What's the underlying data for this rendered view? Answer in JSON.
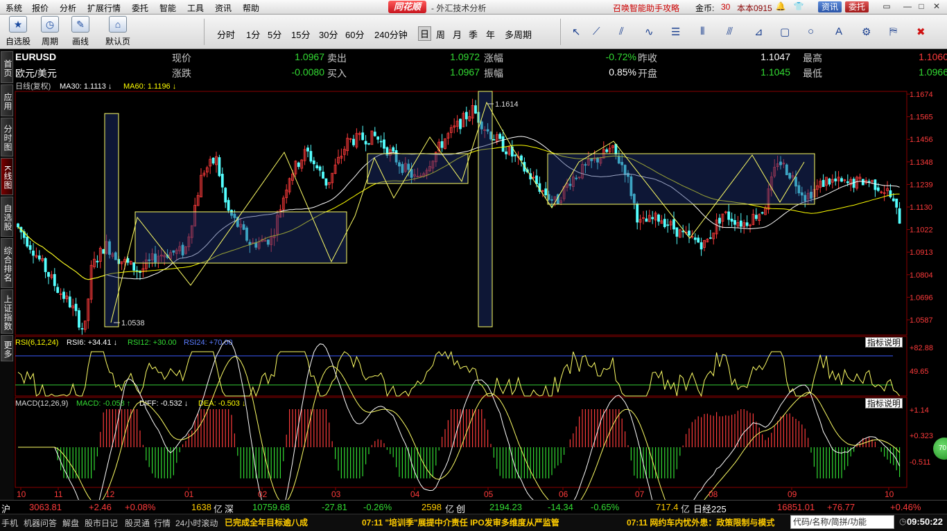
{
  "menubar": {
    "items": [
      "系统",
      "报价",
      "分析",
      "扩展行情",
      "委托",
      "智能",
      "工具",
      "资讯",
      "帮助"
    ],
    "brand": "同花顺",
    "title": "- 外汇技术分析",
    "promo": "召唤智能助手攻略",
    "gold_label": "金币:",
    "gold_value": "30",
    "username": "本本0915",
    "news_btn": "资讯",
    "trade_btn": "委托"
  },
  "toolbar": {
    "buttons": [
      {
        "label": "自选股",
        "icon": "star-icon"
      },
      {
        "label": "周期",
        "icon": "clock-icon"
      },
      {
        "label": "画线",
        "icon": "pencil-icon"
      },
      {
        "label": "默认页",
        "icon": "home-icon"
      }
    ],
    "periods": [
      "分时",
      "1分",
      "5分",
      "15分",
      "30分",
      "60分",
      "240分钟",
      "日",
      "周",
      "月",
      "季",
      "年",
      "多周期"
    ],
    "selected_period": "日"
  },
  "sidebar": {
    "tabs": [
      "首页",
      "应用",
      "分时图",
      "K线图",
      "自选股",
      "综合排名",
      "上证指数",
      "更多"
    ],
    "active": "K线图"
  },
  "quote": {
    "symbol": "EURUSD",
    "name": "欧元/美元",
    "row1": [
      {
        "label": "现价",
        "value": "1.0967",
        "color": "green"
      },
      {
        "label": "卖出",
        "value": "1.0972",
        "color": "green"
      },
      {
        "label": "涨幅",
        "value": "-0.72%",
        "color": "green"
      },
      {
        "label": "昨收",
        "value": "1.1047",
        "color": "white"
      },
      {
        "label": "最高",
        "value": "1.1060",
        "color": "red"
      }
    ],
    "row2": [
      {
        "label": "涨跌",
        "value": "-0.0080",
        "color": "green"
      },
      {
        "label": "买入",
        "value": "1.0967",
        "color": "green"
      },
      {
        "label": "振幅",
        "value": "0.85%",
        "color": "white"
      },
      {
        "label": "开盘",
        "value": "1.1045",
        "color": "green"
      },
      {
        "label": "最低",
        "value": "1.0966",
        "color": "green"
      }
    ]
  },
  "kline": {
    "header_type": "日线(复权)",
    "ma30_label": "MA30: 1.1113",
    "ma60_label": "MA60: 1.1196",
    "y_ticks": [
      "1.1674",
      "1.1565",
      "1.1456",
      "1.1348",
      "1.1239",
      "1.1130",
      "1.1022",
      "1.0913",
      "1.0804",
      "1.0696",
      "1.0587"
    ],
    "annot_high": "1.1614",
    "annot_low": "1.0538"
  },
  "rsi": {
    "label": "RSI(6,12,24)",
    "rsi6": "RSI6: +34.41",
    "rsi12": "RSI12: +30.00",
    "rsi24": "RSI24: +70.00",
    "ticks": [
      "+82.88",
      "49.65"
    ],
    "button": "指标说明"
  },
  "macd": {
    "label": "MACD(12,26,9)",
    "macd": "MACD: -0.058",
    "diff": "DIFF: -0.532",
    "dea": "DEA: -0.503",
    "ticks": [
      "+1.14",
      "+0.323",
      "-0.511"
    ],
    "button": "指标说明"
  },
  "xaxis": [
    "10",
    "11",
    "12",
    "01",
    "02",
    "03",
    "04",
    "05",
    "06",
    "07",
    "08",
    "09",
    "10"
  ],
  "status1": [
    {
      "t": "沪",
      "c": "#fff"
    },
    {
      "t": "3063.81",
      "c": "#ff3b3b"
    },
    {
      "t": "+2.46",
      "c": "#ff3b3b"
    },
    {
      "t": "+0.08%",
      "c": "#ff3b3b"
    },
    {
      "t": "1638",
      "c": "#ffcc00"
    },
    {
      "t": "亿",
      "c": "#ddd"
    },
    {
      "t": "深",
      "c": "#fff"
    },
    {
      "t": "10759.68",
      "c": "#33dd33"
    },
    {
      "t": "-27.81",
      "c": "#33dd33"
    },
    {
      "t": "-0.26%",
      "c": "#33dd33"
    },
    {
      "t": "2598",
      "c": "#ffcc00"
    },
    {
      "t": "亿",
      "c": "#ddd"
    },
    {
      "t": "创",
      "c": "#fff"
    },
    {
      "t": "2194.23",
      "c": "#33dd33"
    },
    {
      "t": "-14.34",
      "c": "#33dd33"
    },
    {
      "t": "-0.65%",
      "c": "#33dd33"
    },
    {
      "t": "717.4",
      "c": "#ffcc00"
    },
    {
      "t": "亿",
      "c": "#ddd"
    },
    {
      "t": "日经225",
      "c": "#fff"
    },
    {
      "t": "16851.01",
      "c": "#ff3b3b"
    },
    {
      "t": "+76.77",
      "c": "#ff3b3b"
    },
    {
      "t": "+0.46%",
      "c": "#ff3b3b"
    }
  ],
  "status2": {
    "tabs": [
      "手机",
      "机器问答",
      "解盘",
      "股市日记",
      "股灵通",
      "行情",
      "24小时滚动"
    ],
    "news": [
      "已完成全年目标逾八成",
      "07:11 \"培训季\"展提中介责任 IPO发审多维度从严监管",
      "07:11 网约车内忧外患：政策限制与模式"
    ],
    "code_placeholder": "代码/名称/简拼/功能",
    "time": "09:50:22",
    "ball": "70"
  }
}
